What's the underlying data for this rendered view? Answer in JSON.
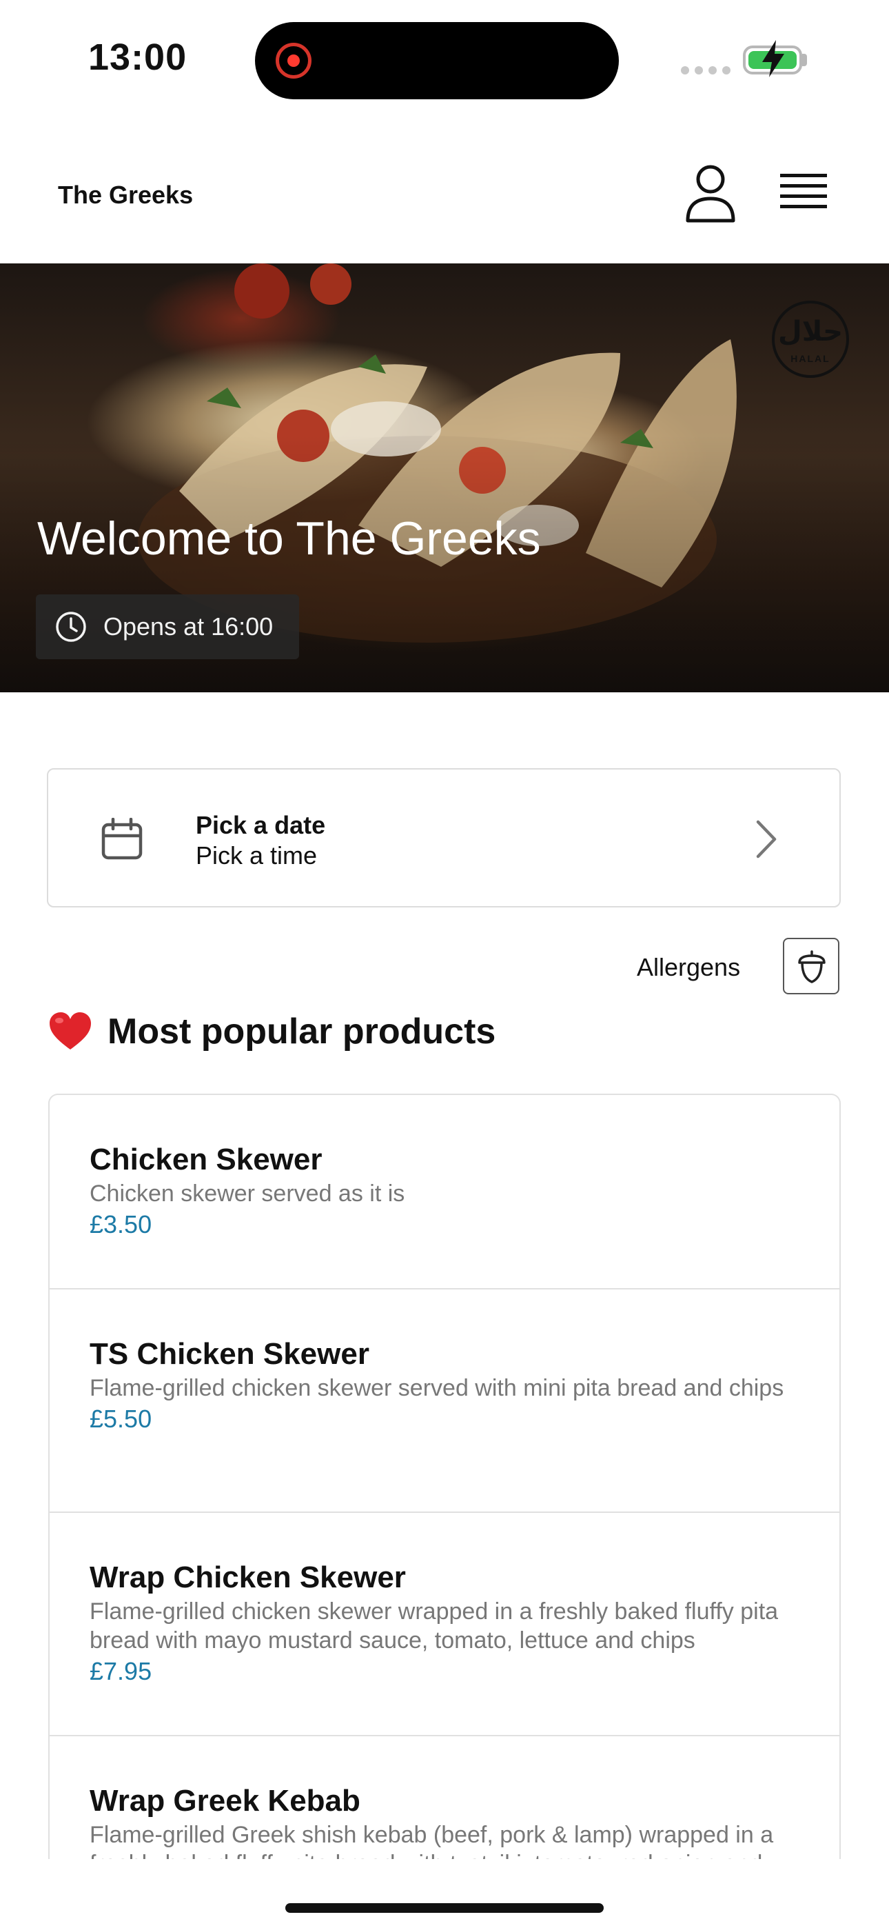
{
  "status_bar": {
    "time": "13:00"
  },
  "header": {
    "brand": "The Greeks",
    "profile_icon": "person-icon",
    "menu_icon": "hamburger-menu-icon"
  },
  "hero": {
    "title": "Welcome to The Greeks",
    "hours": "Opens at 16:00",
    "badge_arabic": "حلال",
    "badge_text": "HALAL"
  },
  "schedule": {
    "date_label": "Pick a date",
    "time_label": "Pick a time"
  },
  "allergens": {
    "label": "Allergens",
    "icon": "acorn-icon"
  },
  "popular": {
    "title": "Most popular products",
    "icon": "heart-icon",
    "items": [
      {
        "name": "Chicken Skewer",
        "description": "Chicken skewer served as it is",
        "price": "£3.50"
      },
      {
        "name": "TS Chicken Skewer",
        "description": "Flame-grilled chicken skewer served with mini pita bread and chips",
        "price": "£5.50"
      },
      {
        "name": "Wrap Chicken Skewer",
        "description": "Flame-grilled chicken skewer wrapped in a freshly baked fluffy pita bread with mayo mustard sauce, tomato, lettuce and chips",
        "price": "£7.95"
      },
      {
        "name": "Wrap Greek Kebab",
        "description": "Flame-grilled Greek shish kebab (beef, pork & lamp) wrapped in a freshly baked fluffy pita bread with tzatziki, tomato, red onion and chips",
        "price": ""
      }
    ]
  },
  "colors": {
    "price": "#1c7aa6",
    "recording": "#ff3b30",
    "battery": "#3cc457"
  }
}
